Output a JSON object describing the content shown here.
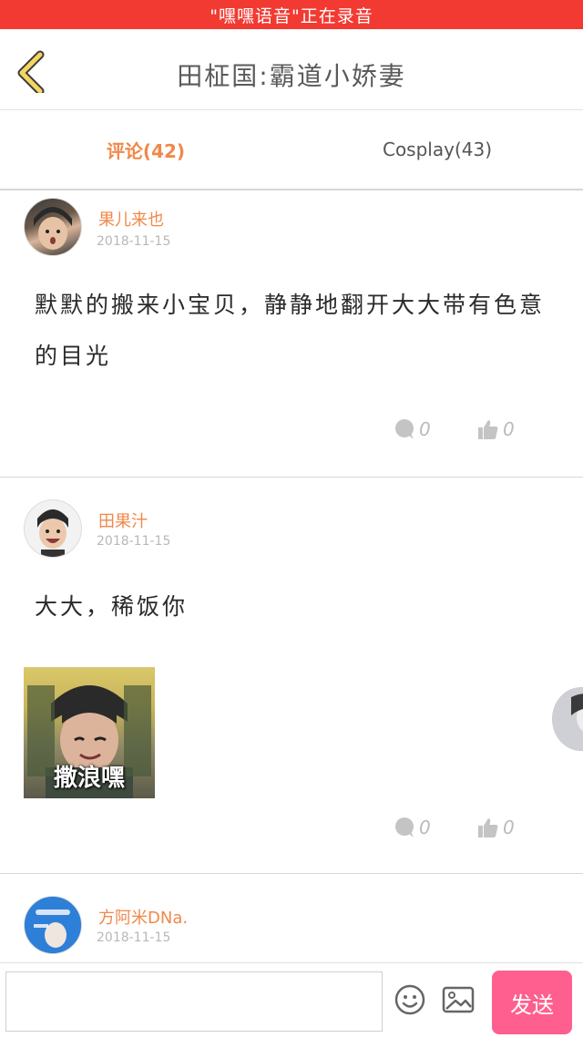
{
  "status_bar": {
    "recording_text": "\"嘿嘿语音\"正在录音"
  },
  "header": {
    "title": "田柾国:霸道小娇妻",
    "back_icon": "chevron-left-icon"
  },
  "tabs": [
    {
      "label": "评论(42)",
      "active": true
    },
    {
      "label": "Cosplay(43)",
      "active": false
    }
  ],
  "comments": [
    {
      "author": "果儿来也",
      "date": "2018-11-15",
      "text": "默默的搬来小宝贝，静静地翻开大大带有色意的目光",
      "reply_count": "0",
      "like_count": "0"
    },
    {
      "author": "田果汁",
      "date": "2018-11-15",
      "text": "大大，稀饭你",
      "sticker_caption": "撒浪嘿",
      "reply_count": "0",
      "like_count": "0"
    },
    {
      "author": "方阿米DNa.",
      "date": "2018-11-15"
    }
  ],
  "composer": {
    "input_placeholder": "",
    "emoji_icon": "smiley-icon",
    "image_icon": "image-icon",
    "send_label": "发送"
  },
  "colors": {
    "recording": "#f23a32",
    "accent": "#f0884a",
    "send": "#ff5f8e"
  }
}
